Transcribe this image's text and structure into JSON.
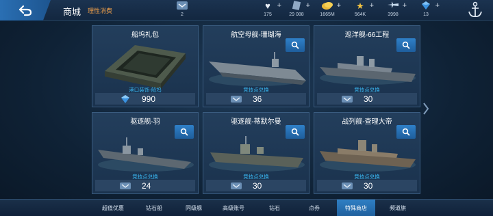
{
  "header": {
    "title": "商城",
    "subtitle": "理性消费",
    "resources": [
      {
        "icon": "medal-icon",
        "value": "2",
        "has_plus": false
      },
      {
        "icon": "heart-icon",
        "value": "175",
        "has_plus": true
      },
      {
        "icon": "document-icon",
        "value": "29 088",
        "has_plus": true
      },
      {
        "icon": "gold-coin-icon",
        "value": "1665M",
        "has_plus": true
      },
      {
        "icon": "star-icon",
        "value": "564K",
        "has_plus": true
      },
      {
        "icon": "aircraft-icon",
        "value": "3998",
        "has_plus": true
      },
      {
        "icon": "gem-icon",
        "value": "13",
        "has_plus": true
      }
    ],
    "plus_symbol": "+"
  },
  "cards": [
    {
      "title": "船坞礼包",
      "note": "港口装饰-船坞",
      "price": "990",
      "currency_icon": "diamond-icon",
      "has_zoom": false
    },
    {
      "title": "航空母舰-珊瑚海",
      "note": "竞技点兑换",
      "price": "36",
      "currency_icon": "arena-medal-icon",
      "has_zoom": true
    },
    {
      "title": "巡洋舰-66工程",
      "note": "竞技点兑换",
      "price": "30",
      "currency_icon": "arena-medal-icon",
      "has_zoom": true
    },
    {
      "title": "驱逐舰-羽",
      "note": "竞技点兑换",
      "price": "24",
      "currency_icon": "arena-medal-icon",
      "has_zoom": true
    },
    {
      "title": "驱逐舰-蒂默尔曼",
      "note": "竞技点兑换",
      "price": "30",
      "currency_icon": "arena-medal-icon",
      "has_zoom": true
    },
    {
      "title": "战列舰-查理大帝",
      "note": "竞技点兑换",
      "price": "30",
      "currency_icon": "arena-medal-icon",
      "has_zoom": true
    }
  ],
  "tabs": [
    {
      "label": "超值优惠",
      "active": false
    },
    {
      "label": "钻石船",
      "active": false
    },
    {
      "label": "同级舰",
      "active": false
    },
    {
      "label": "高级账号",
      "active": false
    },
    {
      "label": "钻石",
      "active": false
    },
    {
      "label": "点券",
      "active": false
    },
    {
      "label": "特殊商店",
      "active": true
    },
    {
      "label": "频道旗",
      "active": false
    }
  ],
  "colors": {
    "accent": "#2f80c8",
    "subtitle": "#f0a04a",
    "note": "#39b6f0"
  }
}
